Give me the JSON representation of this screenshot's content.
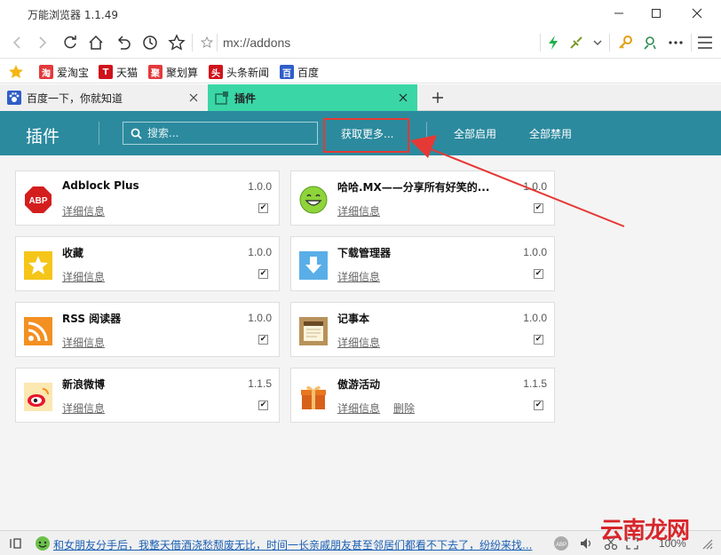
{
  "window": {
    "title": "万能浏览器 1.1.49"
  },
  "nav": {
    "address": "mx://addons"
  },
  "bookmarks": [
    {
      "label": "爱淘宝",
      "icon": "taobao-icon",
      "icon_text": "淘",
      "color": "#e4393c"
    },
    {
      "label": "天猫",
      "icon": "tmall-icon",
      "icon_text": "T",
      "color": "#d0121b"
    },
    {
      "label": "聚划算",
      "icon": "juhuasuan-icon",
      "icon_text": "聚",
      "color": "#e4393c"
    },
    {
      "label": "头条新闻",
      "icon": "toutiao-icon",
      "icon_text": "头",
      "color": "#d0121b"
    },
    {
      "label": "百度",
      "icon": "baidu-icon",
      "icon_text": "百",
      "color": "#2f5ec8"
    }
  ],
  "tabs": [
    {
      "label": "百度一下，你就知道",
      "active": false
    },
    {
      "label": "插件",
      "active": true
    }
  ],
  "header": {
    "title": "插件",
    "search_placeholder": "搜索...",
    "get_more": "获取更多...",
    "enable_all": "全部启用",
    "disable_all": "全部禁用"
  },
  "addons": [
    {
      "name": "Adblock Plus",
      "version": "1.0.0",
      "link": "详细信息",
      "icon": "adblock-plus-icon",
      "icon_text": "ABP",
      "checked": true
    },
    {
      "name": "哈哈.MX——分享所有好笑的...",
      "version": "1.0.0",
      "link": "详细信息",
      "icon": "smiley-icon",
      "checked": true
    },
    {
      "name": "收藏",
      "version": "1.0.0",
      "link": "详细信息",
      "icon": "star-icon",
      "checked": true
    },
    {
      "name": "下载管理器",
      "version": "1.0.0",
      "link": "详细信息",
      "icon": "download-icon",
      "checked": true
    },
    {
      "name": "RSS 阅读器",
      "version": "1.0.0",
      "link": "详细信息",
      "icon": "rss-icon",
      "checked": true
    },
    {
      "name": "记事本",
      "version": "1.0.0",
      "link": "详细信息",
      "icon": "notepad-icon",
      "checked": true
    },
    {
      "name": "新浪微博",
      "version": "1.1.5",
      "link": "详细信息",
      "icon": "weibo-icon",
      "checked": true
    },
    {
      "name": "傲游活动",
      "version": "1.1.5",
      "link": "详细信息",
      "link2": "删除",
      "icon": "gift-icon",
      "checked": true
    }
  ],
  "status": {
    "news": "和女朋友分手后，我整天借酒浇愁颓废无比，时间一长亲戚朋友甚至邻居们都看不下去了，纷纷来找...",
    "zoom": "100%"
  },
  "watermark": "云南龙网",
  "colors": {
    "accent": "#2c8a9e",
    "tab_active": "#3ad6a6",
    "highlight": "#e53935"
  }
}
